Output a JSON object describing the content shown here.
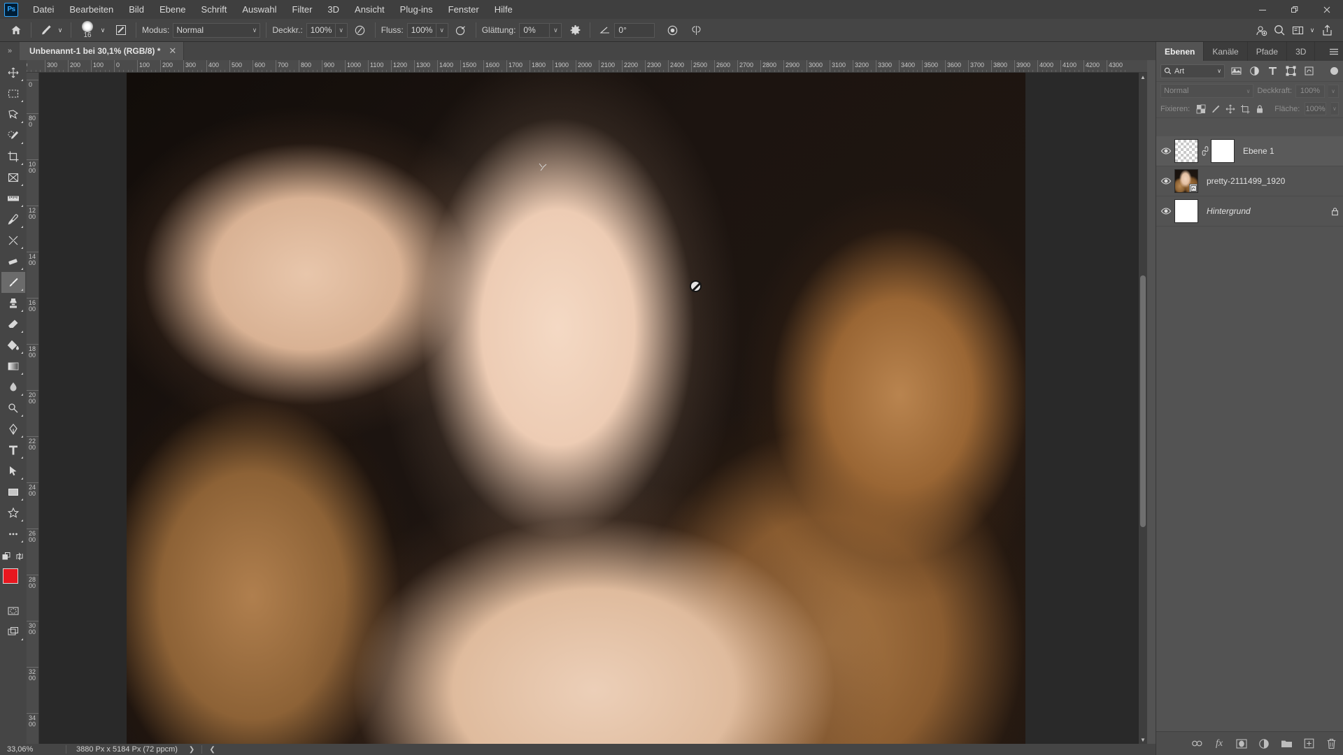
{
  "app": {
    "logo": "Ps",
    "menu": [
      "Datei",
      "Bearbeiten",
      "Bild",
      "Ebene",
      "Schrift",
      "Auswahl",
      "Filter",
      "3D",
      "Ansicht",
      "Plug-ins",
      "Fenster",
      "Hilfe"
    ],
    "window_controls": [
      {
        "name": "minimize",
        "glyph": "─"
      },
      {
        "name": "restore",
        "glyph": "❐"
      },
      {
        "name": "close",
        "glyph": "✕"
      }
    ],
    "right_icons": [
      {
        "name": "share-user-icon",
        "glyph": "☺"
      },
      {
        "name": "search-icon",
        "glyph": "⌕"
      },
      {
        "name": "workspace-icon",
        "glyph": "▣"
      },
      {
        "name": "chevron-down-icon",
        "glyph": "∨"
      },
      {
        "name": "share-icon",
        "glyph": "⇧"
      }
    ]
  },
  "options_bar": {
    "home_icon": "home-icon",
    "tool_preset_icon": "brush-tool-icon",
    "brush_size": "16",
    "brush_panel_icon": "brush-settings-icon",
    "mode_label": "Modus:",
    "mode_value": "Normal",
    "opacity_label": "Deckkr.:",
    "opacity_value": "100%",
    "pressure_opacity_icon": "pressure-opacity-icon",
    "flow_label": "Fluss:",
    "flow_value": "100%",
    "airbrush_icon": "airbrush-icon",
    "smoothing_label": "Glättung:",
    "smoothing_value": "0%",
    "smoothing_gear_icon": "gear-icon",
    "angle_icon": "angle-icon",
    "angle_value": "0°",
    "pressure_size_icon": "pressure-size-icon",
    "symmetry_icon": "symmetry-butterfly-icon"
  },
  "tabbar": {
    "grip_icon": "panel-expand-icon",
    "tabs": [
      {
        "title": "Unbenannt-1 bei 30,1% (RGB/8) *",
        "close": "✕",
        "active": true
      }
    ]
  },
  "toolbar": {
    "tools": [
      {
        "name": "move-tool",
        "title": "Verschieben-Werkzeug",
        "active": false
      },
      {
        "name": "rectangular-marquee-tool",
        "title": "Auswahlrechteck-Werkzeug",
        "active": false
      },
      {
        "name": "lasso-tool",
        "title": "Lasso-Werkzeug",
        "active": false
      },
      {
        "name": "object-selection-tool",
        "title": "Objektauswahl-Werkzeug",
        "active": false
      },
      {
        "name": "crop-tool",
        "title": "Freistellungswerkzeug",
        "active": false
      },
      {
        "name": "frame-tool",
        "title": "Rahmenwerkzeug",
        "active": false
      },
      {
        "name": "measure-tool",
        "title": "Messwerkzeug",
        "active": false
      },
      {
        "name": "eyedropper-tool",
        "title": "Pipette",
        "active": false
      },
      {
        "name": "healing-brush-tool",
        "title": "Reparatur-Pinsel",
        "active": false
      },
      {
        "name": "patch-tool",
        "title": "Ausbessern-Werkzeug",
        "active": false
      },
      {
        "name": "brush-tool",
        "title": "Pinselwerkzeug",
        "active": true
      },
      {
        "name": "clone-stamp-tool",
        "title": "Kopierstempel",
        "active": false
      },
      {
        "name": "eraser-tool",
        "title": "Radiergummi",
        "active": false
      },
      {
        "name": "paint-bucket-tool",
        "title": "Füllwerkzeug",
        "active": false
      },
      {
        "name": "gradient-tool",
        "title": "Verlaufswerkzeug",
        "active": false
      },
      {
        "name": "blur-tool",
        "title": "Weichzeichner",
        "active": false
      },
      {
        "name": "dodge-tool",
        "title": "Abwedler",
        "active": false
      },
      {
        "name": "pen-tool",
        "title": "Zeichenstift",
        "active": false
      },
      {
        "name": "type-tool",
        "title": "Textwerkzeug",
        "active": false
      },
      {
        "name": "path-selection-tool",
        "title": "Pfadauswahl-Werkzeug",
        "active": false
      },
      {
        "name": "rectangle-tool",
        "title": "Rechteck-Werkzeug",
        "active": false
      },
      {
        "name": "custom-shape-tool",
        "title": "Eigene-Form-Werkzeug",
        "active": false
      },
      {
        "name": "more-tools",
        "title": "Weitere Werkzeuge",
        "active": false
      }
    ],
    "edit-toolbar-icon": "edit-toolbar-icon",
    "swap-colors-icon": "swap-colors-icon",
    "foreground_color": "#e8171f",
    "background_color": "#ffffff",
    "quickmask_icon": "quick-mask-icon",
    "screenmode_icon": "screen-mode-icon"
  },
  "rulers": {
    "horizontal": [
      "0",
      "300",
      "200",
      "100",
      "0",
      "100",
      "200",
      "300",
      "400",
      "500",
      "600",
      "700",
      "800",
      "900",
      "1000",
      "1100",
      "1200",
      "1300",
      "1400",
      "1500",
      "1600",
      "1700",
      "1800",
      "1900",
      "2000",
      "2100",
      "2200",
      "2300",
      "2400",
      "2500",
      "2600",
      "2700",
      "2800",
      "2900",
      "3000",
      "3100",
      "3200",
      "3300",
      "3400",
      "3500",
      "3600",
      "3700",
      "3800",
      "3900",
      "4000",
      "4100",
      "4200",
      "4300"
    ],
    "vertical": [
      "0",
      "800",
      "1000",
      "1200",
      "1400",
      "1600",
      "1800",
      "2000",
      "2200",
      "2400",
      "2600",
      "2800",
      "3000",
      "3200",
      "3400"
    ]
  },
  "canvas": {
    "cursor_no_entry_icon": "no-entry-cursor-icon",
    "cursor_brush_icon": "brush-cursor-icon"
  },
  "statusbar": {
    "zoom": "33,06%",
    "dimensions": "3880 Px x 5184 Px (72 ppcm)",
    "next_arrow": "❯",
    "prev_arrow": "❮"
  },
  "layers_panel": {
    "tabs": [
      {
        "label": "Ebenen",
        "active": true
      },
      {
        "label": "Kanäle",
        "active": false
      },
      {
        "label": "Pfade",
        "active": false
      },
      {
        "label": "3D",
        "active": false
      }
    ],
    "menu_icon": "panel-menu-icon",
    "filter": {
      "search_icon": "search-icon",
      "value": "Art",
      "chevron": "∨",
      "icons": [
        {
          "name": "filter-pixel-icon",
          "glyph": "▣"
        },
        {
          "name": "filter-adjustment-icon",
          "glyph": "◑"
        },
        {
          "name": "filter-type-icon",
          "glyph": "T"
        },
        {
          "name": "filter-shape-icon",
          "glyph": "□"
        },
        {
          "name": "filter-smart-object-icon",
          "glyph": "❑"
        }
      ],
      "toggle_name": "filter-toggle"
    },
    "blend_mode_label": "Normal",
    "blend_chevron": "∨",
    "opacity_label": "Deckkraft:",
    "opacity_value": "100%",
    "lock_label": "Fixieren:",
    "lock_icons": [
      {
        "name": "lock-transparency-icon",
        "glyph": "▦"
      },
      {
        "name": "lock-image-icon",
        "glyph": "✐"
      },
      {
        "name": "lock-position-icon",
        "glyph": "✥"
      },
      {
        "name": "lock-artboard-icon",
        "glyph": "⬚"
      },
      {
        "name": "lock-all-icon",
        "glyph": "ὑ2"
      }
    ],
    "fill_label": "Fläche:",
    "fill_value": "100%",
    "layers": [
      {
        "name": "Ebene 1",
        "visible": true,
        "selected": true,
        "thumb_type": "checker",
        "has_mask": true,
        "link_icon": "link-icon",
        "locked": false,
        "italic": false
      },
      {
        "name": "pretty-2111499_1920",
        "visible": true,
        "selected": false,
        "thumb_type": "photo",
        "has_mask": false,
        "smart_object_badge": "smart-object-icon",
        "locked": false,
        "italic": false
      },
      {
        "name": "Hintergrund",
        "visible": true,
        "selected": false,
        "thumb_type": "white",
        "has_mask": false,
        "locked": true,
        "lock_icon": "lock-icon",
        "italic": true
      }
    ],
    "footer_icons": [
      {
        "name": "link-layers-icon",
        "glyph": "∞"
      },
      {
        "name": "layer-style-fx-icon",
        "glyph": "fx"
      },
      {
        "name": "add-mask-icon",
        "glyph": "▣"
      },
      {
        "name": "adjustment-layer-icon",
        "glyph": "◑"
      },
      {
        "name": "new-group-icon",
        "glyph": "▮"
      },
      {
        "name": "new-layer-icon",
        "glyph": "⊞"
      },
      {
        "name": "delete-layer-icon",
        "glyph": "Ὕ1"
      }
    ]
  }
}
